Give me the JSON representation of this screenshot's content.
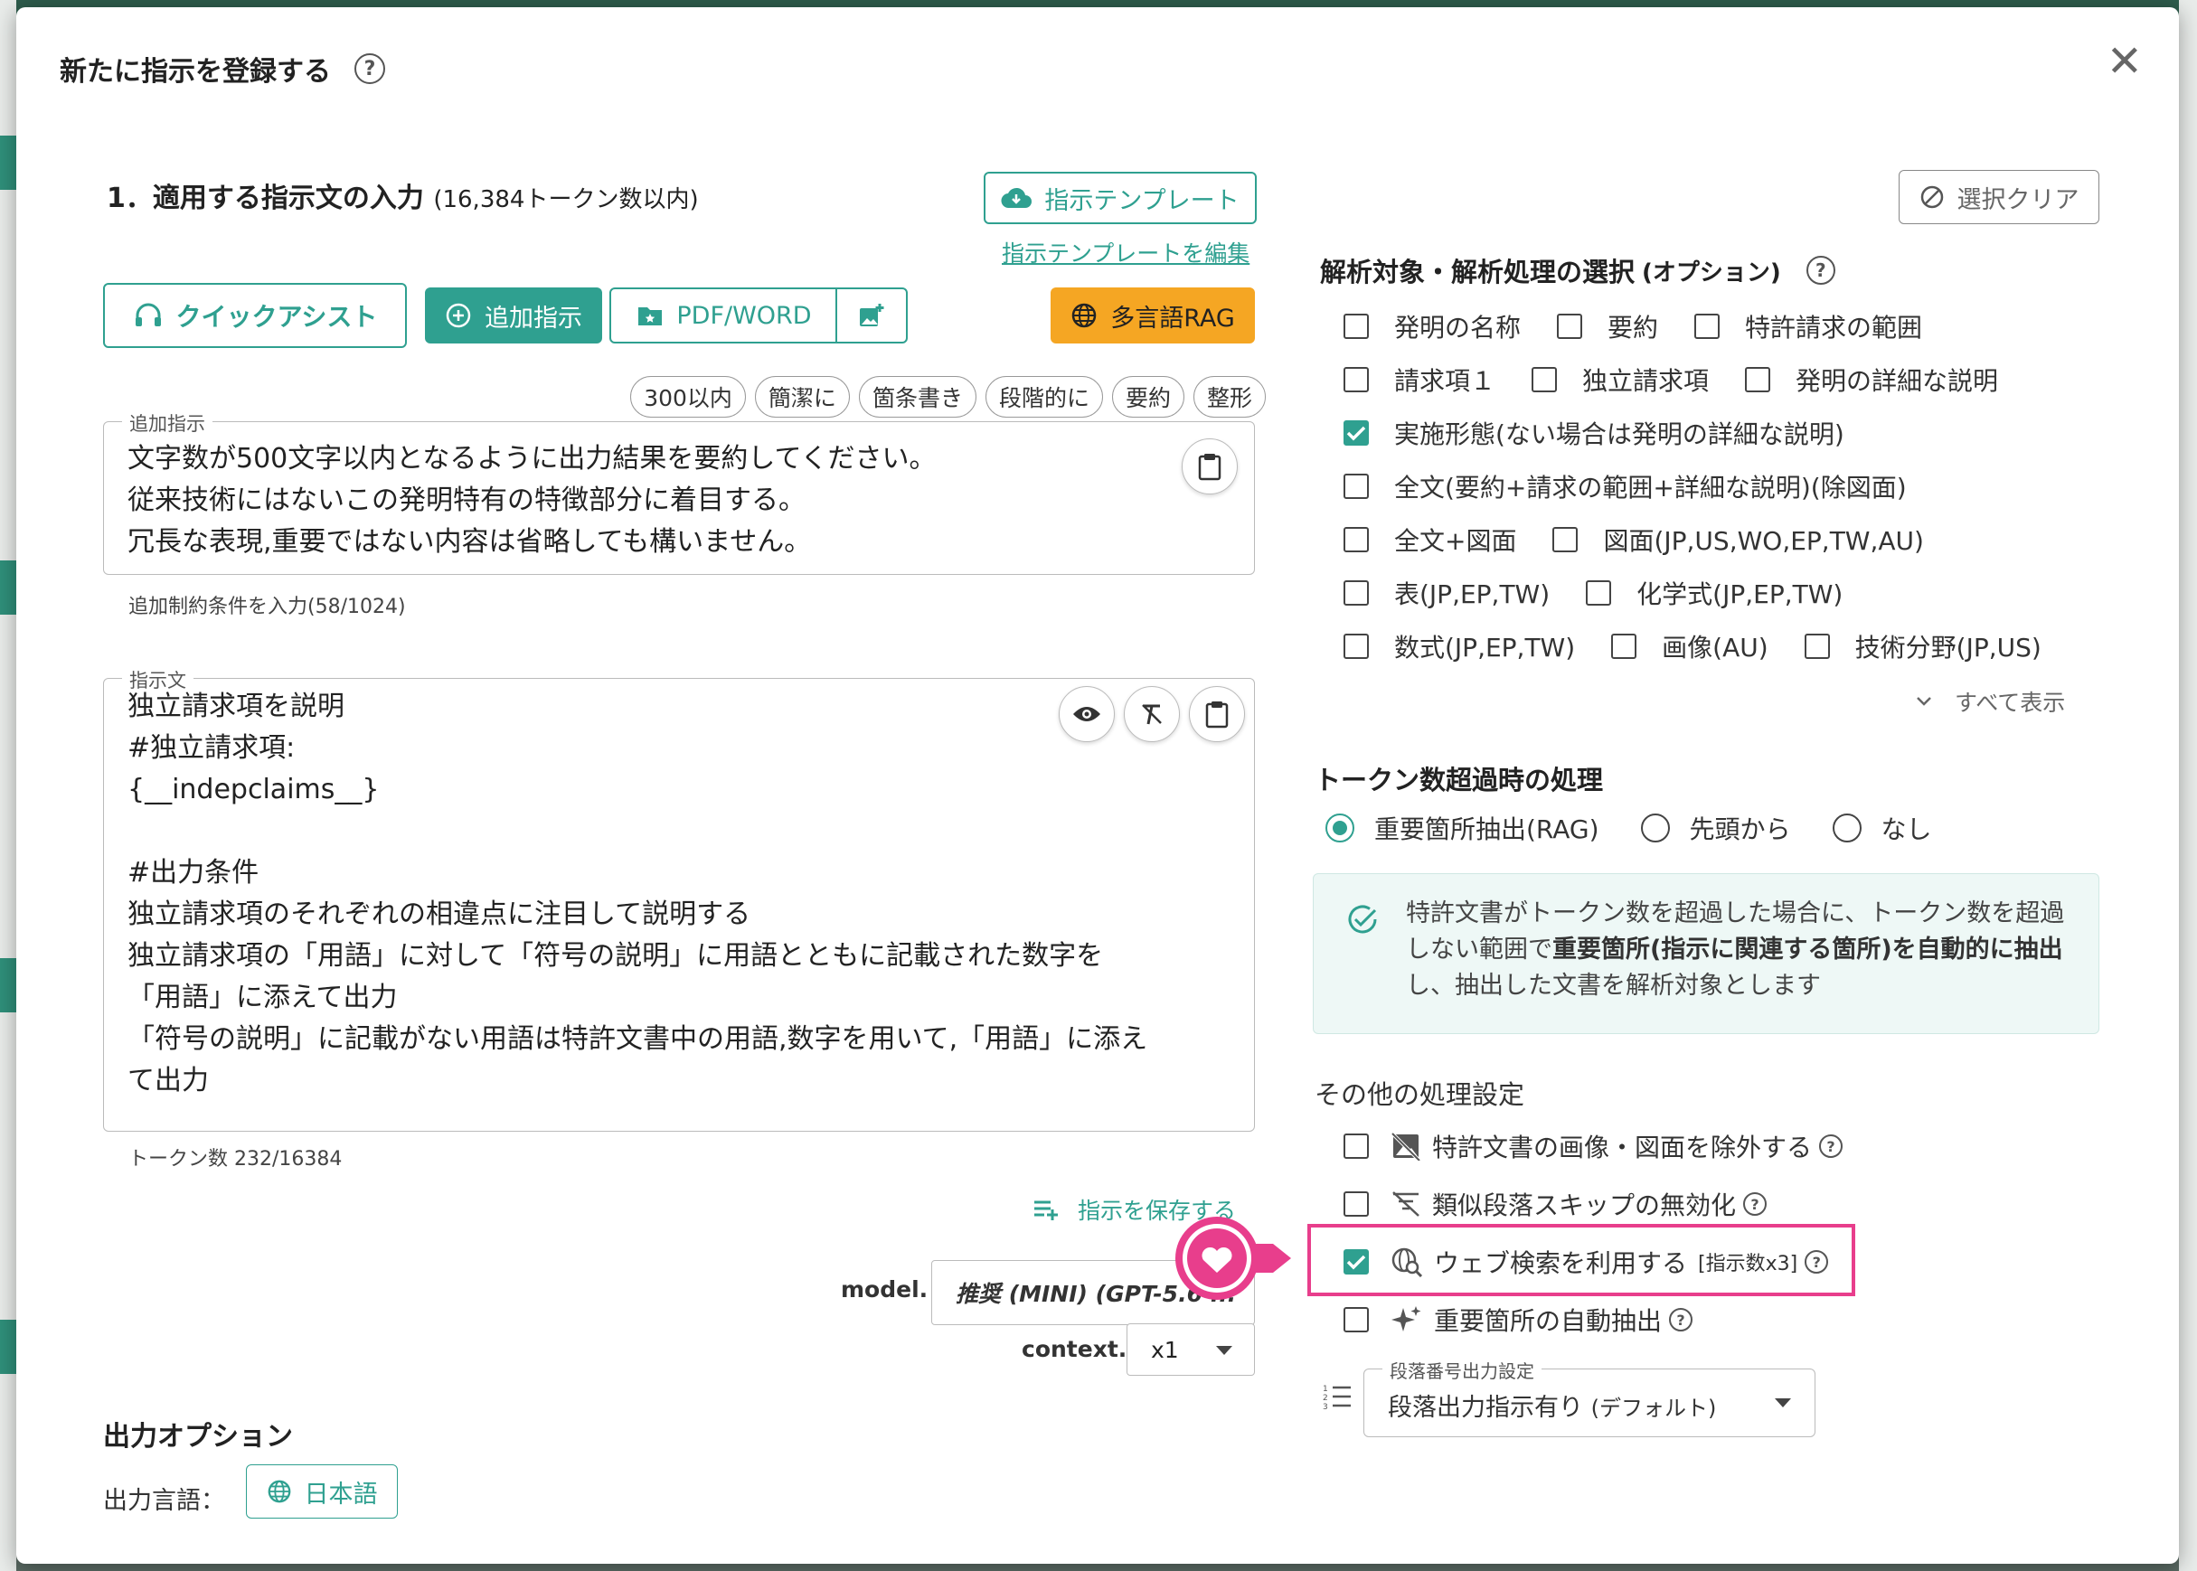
{
  "modal": {
    "title": "新たに指示を登録する",
    "help": "?",
    "close": "✕"
  },
  "section1": {
    "title": "1．適用する指示文の入力",
    "token_limit": "(16,384トークン数以内)",
    "template_button": "指示テンプレート",
    "edit_template_link": "指示テンプレートを編集"
  },
  "toolbar": {
    "quick_assist": "クイックアシスト",
    "add_instruction": "追加指示",
    "pdf_word": "PDF/WORD",
    "multi_rag": "多言語RAG"
  },
  "chips": [
    "300以内",
    "簡潔に",
    "箇条書き",
    "段階的に",
    "要約",
    "整形"
  ],
  "additional": {
    "legend": "追加指示",
    "text": "文字数が500文字以内となるように出力結果を要約してください。\n従来技術にはないこの発明特有の特徴部分に着目する。\n冗長な表現,重要ではない内容は省略しても構いません。",
    "helper": "追加制約条件を入力(58/1024)"
  },
  "instruction": {
    "legend": "指示文",
    "text": "独立請求項を説明\n#独立請求項:\n{__indepclaims__}\n\n#出力条件\n独立請求項のそれぞれの相違点に注目して説明する\n独立請求項の「用語」に対して「符号の説明」に用語とともに記載された数字を\n「用語」に添えて出力\n「符号の説明」に記載がない用語は特許文書中の用語,数字を用いて,「用語」に添え\nて出力",
    "helper": "トークン数 232/16384",
    "save_link": "指示を保存する"
  },
  "model": {
    "label": "model.",
    "value": "推奨 (MINI) (GPT-5.6 ...",
    "context_label": "context.",
    "context_value": "x1"
  },
  "output": {
    "title": "出力オプション",
    "lang_label": "出力言語：",
    "lang_value": "日本語"
  },
  "right": {
    "clear_button": "選択クリア",
    "analysis_title": "解析対象・解析処理の選択",
    "analysis_option": "(オプション)",
    "rows": [
      [
        {
          "label": "発明の名称",
          "checked": false
        },
        {
          "label": "要約",
          "checked": false
        },
        {
          "label": "特許請求の範囲",
          "checked": false
        }
      ],
      [
        {
          "label": "請求項１",
          "checked": false
        },
        {
          "label": "独立請求項",
          "checked": false
        },
        {
          "label": "発明の詳細な説明",
          "checked": false
        }
      ],
      [
        {
          "label": "実施形態(ない場合は発明の詳細な説明)",
          "checked": true
        }
      ],
      [
        {
          "label": "全文(要約+請求の範囲+詳細な説明)(除図面)",
          "checked": false
        }
      ],
      [
        {
          "label": "全文+図面",
          "checked": false
        },
        {
          "label": "図面(JP,US,WO,EP,TW,AU)",
          "checked": false
        }
      ],
      [
        {
          "label": "表(JP,EP,TW)",
          "checked": false
        },
        {
          "label": "化学式(JP,EP,TW)",
          "checked": false
        }
      ],
      [
        {
          "label": "数式(JP,EP,TW)",
          "checked": false
        },
        {
          "label": "画像(AU)",
          "checked": false
        },
        {
          "label": "技術分野(JP,US)",
          "checked": false
        }
      ]
    ],
    "show_all": "すべて表示",
    "token_title": "トークン数超過時の処理",
    "radios": [
      {
        "label": "重要箇所抽出(RAG)",
        "selected": true
      },
      {
        "label": "先頭から",
        "selected": false
      },
      {
        "label": "なし",
        "selected": false
      }
    ],
    "info_pre": "特許文書がトークン数を超過した場合に、トークン数を超過しない範囲で",
    "info_bold": "重要箇所(指示に関連する箇所)を自動的に抽出",
    "info_post": "し、抽出した文書を解析対象とします",
    "other_title": "その他の処理設定",
    "other": [
      {
        "label": "特許文書の画像・図面を除外する",
        "checked": false,
        "icon": "image-off-icon"
      },
      {
        "label": "類似段落スキップの無効化",
        "checked": false,
        "icon": "filter-off-icon"
      },
      {
        "label": "ウェブ検索を利用する",
        "extra": "[指示数x3]",
        "checked": true,
        "icon": "web-search-icon"
      },
      {
        "label": "重要箇所の自動抽出",
        "checked": false,
        "icon": "sparkle-icon"
      }
    ],
    "para_legend": "段落番号出力設定",
    "para_value": "段落出力指示有り",
    "para_default": "(デフォルト)"
  },
  "colors": {
    "accent": "#2fa090",
    "orange": "#f5a623",
    "highlight": "#e83e8c"
  }
}
